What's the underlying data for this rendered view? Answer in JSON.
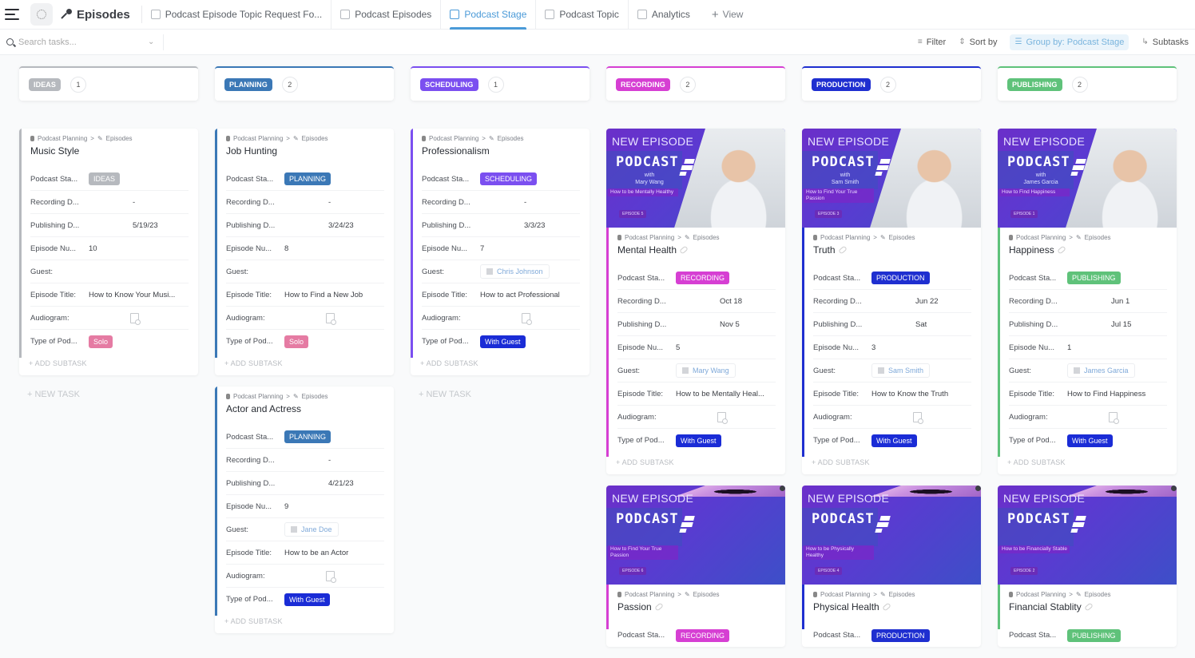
{
  "topbar": {
    "list_name": "Episodes",
    "tabs": [
      {
        "label": "Podcast Episode Topic Request Fo...",
        "active": false
      },
      {
        "label": "Podcast Episodes",
        "active": false
      },
      {
        "label": "Podcast Stage",
        "active": true
      },
      {
        "label": "Podcast Topic",
        "active": false
      },
      {
        "label": "Analytics",
        "active": false
      }
    ],
    "add_view_label": "View"
  },
  "toolbar": {
    "search_placeholder": "Search tasks...",
    "filter_label": "Filter",
    "sort_label": "Sort by",
    "group_label": "Group by: Podcast Stage",
    "subtasks_label": "Subtasks"
  },
  "labels": {
    "breadcrumb_space": "Podcast Planning",
    "breadcrumb_list": "Episodes",
    "stage": "Podcast Sta...",
    "recording": "Recording D...",
    "publishing": "Publishing D...",
    "episode_num": "Episode Nu...",
    "guest": "Guest:",
    "episode_title": "Episode Title:",
    "audiogram": "Audiogram:",
    "type": "Type of Pod...",
    "add_subtask": "+ ADD SUBTASK",
    "new_task": "+ NEW TASK"
  },
  "cover_text": {
    "new_episode": "NEW EPISODE",
    "podcast": "PODCAST",
    "with": "with"
  },
  "colors": {
    "ideas": "#b6b9be",
    "planning": "#3b78b6",
    "scheduling": "#7b4ff0",
    "recording": "#d63fd3",
    "production": "#1f2fd0",
    "publishing": "#5fc27a",
    "solo": "#e57ba3",
    "with_guest": "#1a2cd6",
    "accent": "#4a9ad8"
  },
  "columns": [
    {
      "stage": "IDEAS",
      "count": "1",
      "color": "#b6b9be",
      "show_new_task": true,
      "cards": [
        {
          "title": "Music Style",
          "stage": "IDEAS",
          "recording": "-",
          "publishing": "5/19/23",
          "episode_num": "10",
          "guest": "",
          "episode_title": "How to Know Your Musi...",
          "type": "Solo",
          "cover": null
        }
      ]
    },
    {
      "stage": "PLANNING",
      "count": "2",
      "color": "#3b78b6",
      "show_new_task": false,
      "cards": [
        {
          "title": "Job Hunting",
          "stage": "PLANNING",
          "recording": "-",
          "publishing": "3/24/23",
          "episode_num": "8",
          "guest": "",
          "episode_title": "How to Find a New Job",
          "type": "Solo",
          "cover": null
        },
        {
          "title": "Actor and Actress",
          "stage": "PLANNING",
          "recording": "-",
          "publishing": "4/21/23",
          "episode_num": "9",
          "guest": "Jane Doe",
          "episode_title": "How to be an Actor",
          "type": "With Guest",
          "cover": null
        }
      ]
    },
    {
      "stage": "SCHEDULING",
      "count": "1",
      "color": "#7b4ff0",
      "show_new_task": true,
      "cards": [
        {
          "title": "Professionalism",
          "stage": "SCHEDULING",
          "recording": "-",
          "publishing": "3/3/23",
          "episode_num": "7",
          "guest": "Chris Johnson",
          "episode_title": "How to act Professional",
          "type": "With Guest",
          "cover": null
        }
      ]
    },
    {
      "stage": "RECORDING",
      "count": "2",
      "color": "#d63fd3",
      "show_new_task": false,
      "cards": [
        {
          "title": "Mental Health",
          "stage": "RECORDING",
          "recording": "Oct 18",
          "publishing": "Nov 5",
          "episode_num": "5",
          "guest": "Mary Wang",
          "episode_title": "How to be Mentally Heal...",
          "type": "With Guest",
          "cover": {
            "kind": "person",
            "host": "Mary Wang",
            "topic": "How to be Mentally Healthy",
            "episode": "EPISODE 5"
          }
        },
        {
          "title": "Passion",
          "stage": "RECORDING",
          "recording": "",
          "publishing": "",
          "episode_num": "",
          "guest": "",
          "episode_title": "",
          "type": "",
          "cover": {
            "kind": "mic",
            "host": "",
            "topic": "How to Find Your True Passion",
            "episode": "EPISODE 6"
          }
        }
      ]
    },
    {
      "stage": "PRODUCTION",
      "count": "2",
      "color": "#1f2fd0",
      "show_new_task": false,
      "cards": [
        {
          "title": "Truth",
          "stage": "PRODUCTION",
          "recording": "Jun 22",
          "publishing": "Sat",
          "episode_num": "3",
          "guest": "Sam Smith",
          "episode_title": "How to Know the Truth",
          "type": "With Guest",
          "cover": {
            "kind": "person",
            "host": "Sam Smith",
            "topic": "How to Find Your True Passion",
            "episode": "EPISODE 3"
          }
        },
        {
          "title": "Physical Health",
          "stage": "PRODUCTION",
          "recording": "",
          "publishing": "",
          "episode_num": "",
          "guest": "",
          "episode_title": "",
          "type": "",
          "cover": {
            "kind": "mic",
            "host": "",
            "topic": "How to be Physically Healthy",
            "episode": "EPISODE 4"
          }
        }
      ]
    },
    {
      "stage": "PUBLISHING",
      "count": "2",
      "color": "#5fc27a",
      "show_new_task": false,
      "cards": [
        {
          "title": "Happiness",
          "stage": "PUBLISHING",
          "recording": "Jun 1",
          "publishing": "Jul 15",
          "episode_num": "1",
          "guest": "James Garcia",
          "episode_title": "How to Find Happiness",
          "type": "With Guest",
          "cover": {
            "kind": "person",
            "host": "James Garcia",
            "topic": "How to Find Happiness",
            "episode": "EPISODE 1"
          }
        },
        {
          "title": "Financial Stablity",
          "stage": "PUBLISHING",
          "recording": "",
          "publishing": "",
          "episode_num": "",
          "guest": "",
          "episode_title": "",
          "type": "",
          "cover": {
            "kind": "mic",
            "host": "",
            "topic": "How to be Financially Stable",
            "episode": "EPISODE 2"
          }
        }
      ]
    }
  ]
}
